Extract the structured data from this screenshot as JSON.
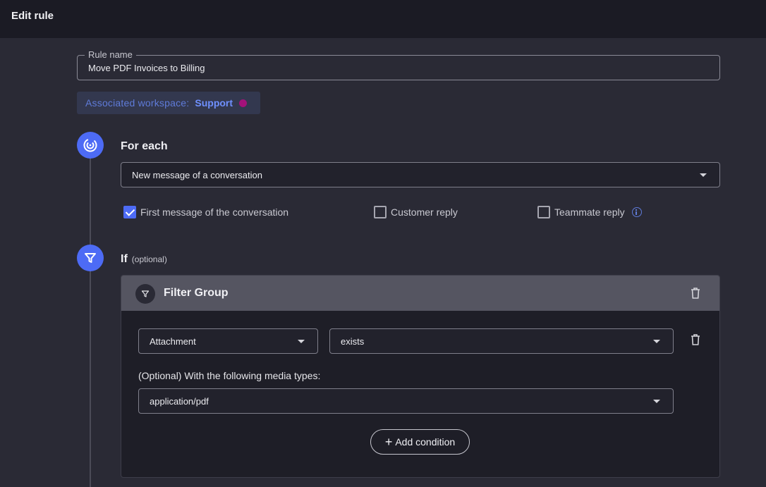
{
  "header": {
    "title": "Edit rule"
  },
  "rule_name": {
    "label": "Rule name",
    "value": "Move PDF Invoices to Billing"
  },
  "workspace": {
    "label": "Associated workspace:",
    "name": "Support",
    "dot_color": "#a3127a"
  },
  "for_each": {
    "title": "For each",
    "trigger_value": "New message of a conversation",
    "checkboxes": [
      {
        "label": "First message of the conversation",
        "checked": true
      },
      {
        "label": "Customer reply",
        "checked": false
      },
      {
        "label": "Teammate reply",
        "checked": false
      }
    ]
  },
  "if_section": {
    "title": "If",
    "optional": "(optional)",
    "filter_group": {
      "title": "Filter Group",
      "condition": {
        "field": "Attachment",
        "operator": "exists"
      },
      "media_label": "(Optional) With the following media types:",
      "media_value": "application/pdf",
      "add_condition": "Add condition"
    }
  },
  "colors": {
    "accent": "#4d6bf5",
    "background": "#2a2a35",
    "topbar": "#1b1b24"
  }
}
